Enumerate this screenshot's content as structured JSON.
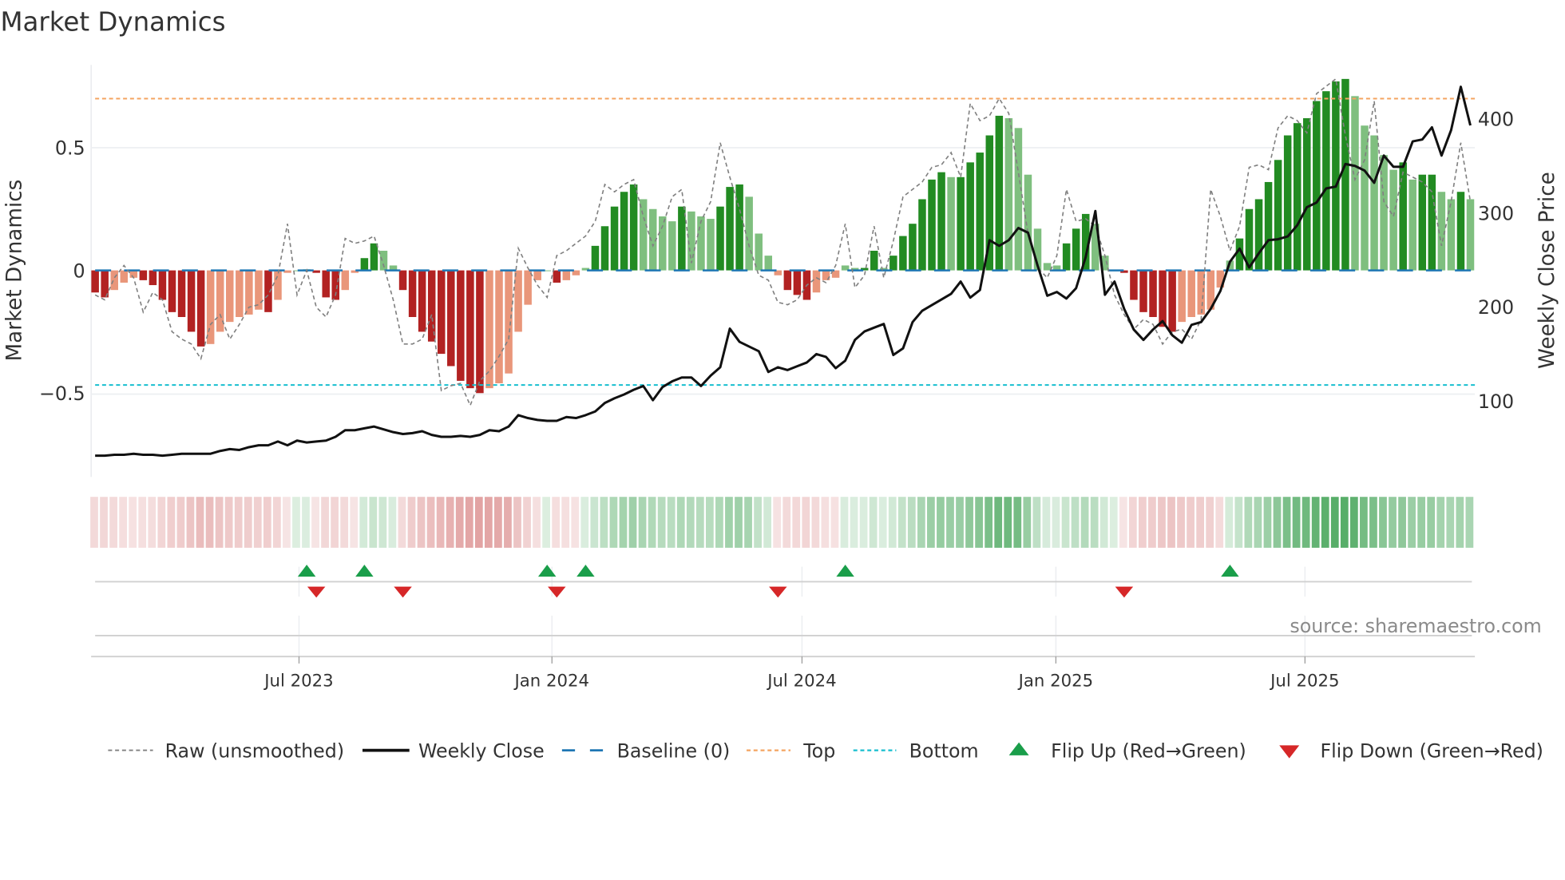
{
  "title": "Market Dynamics",
  "source": "source: sharemaestro.com",
  "legend": {
    "raw": "Raw (unsmoothed)",
    "close": "Weekly Close",
    "baseline": "Baseline (0)",
    "top": "Top",
    "bottom": "Bottom",
    "flip_up": "Flip Up (Red→Green)",
    "flip_down": "Flip Down (Green→Red)"
  },
  "colors": {
    "neg_strong": "#b22222",
    "neg_weak": "#e9967a",
    "pos_strong": "#228b22",
    "pos_weak": "#7fbf7f",
    "raw": "#808080",
    "close": "#111111",
    "baseline": "#1f77b4",
    "top": "#f4a460",
    "bottom": "#17becf",
    "flip_up": "#1a9e4a",
    "flip_down": "#d62728"
  },
  "chart_data": {
    "type": "bar",
    "title": "Market Dynamics",
    "ylabel": "Market Dynamics",
    "ylabel_right": "Weekly Close Price",
    "ylim": [
      -0.8,
      0.85
    ],
    "ylim_right": [
      40,
      440
    ],
    "yticks": [
      {
        "v": 0.5,
        "label": "0.5"
      },
      {
        "v": 0,
        "label": "0"
      },
      {
        "v": -0.5,
        "label": "−0.5"
      }
    ],
    "yticks_right": [
      {
        "v": 100,
        "label": "100"
      },
      {
        "v": 200,
        "label": "200"
      },
      {
        "v": 300,
        "label": "300"
      },
      {
        "v": 400,
        "label": "400"
      }
    ],
    "xticks": [
      {
        "week": 21.2,
        "label": "Jul 2023"
      },
      {
        "week": 47.5,
        "label": "Jan 2024"
      },
      {
        "week": 73.5,
        "label": "Jul 2024"
      },
      {
        "week": 99.9,
        "label": "Jan 2025"
      },
      {
        "week": 125.8,
        "label": "Jul 2025"
      }
    ],
    "top_level": 0.7,
    "bottom_level": -0.467,
    "baseline": 0,
    "histogram": [
      -0.09,
      -0.11,
      -0.08,
      -0.05,
      -0.03,
      -0.04,
      -0.06,
      -0.12,
      -0.17,
      -0.19,
      -0.25,
      -0.31,
      -0.3,
      -0.25,
      -0.21,
      -0.19,
      -0.18,
      -0.16,
      -0.17,
      -0.12,
      -0.01,
      0.0,
      0.004,
      -0.01,
      -0.11,
      -0.12,
      -0.08,
      -0.01,
      0.05,
      0.11,
      0.08,
      0.02,
      -0.08,
      -0.19,
      -0.25,
      -0.29,
      -0.34,
      -0.39,
      -0.45,
      -0.48,
      -0.5,
      -0.48,
      -0.46,
      -0.42,
      -0.25,
      -0.14,
      -0.04,
      0.0,
      -0.05,
      -0.04,
      -0.02,
      0.01,
      0.1,
      0.18,
      0.26,
      0.32,
      0.35,
      0.29,
      0.25,
      0.22,
      0.2,
      0.26,
      0.24,
      0.22,
      0.21,
      0.26,
      0.34,
      0.35,
      0.3,
      0.15,
      0.06,
      -0.02,
      -0.08,
      -0.1,
      -0.12,
      -0.09,
      -0.04,
      -0.03,
      0.02,
      0.01,
      0.01,
      0.08,
      0.01,
      0.06,
      0.14,
      0.19,
      0.29,
      0.37,
      0.4,
      0.38,
      0.38,
      0.44,
      0.48,
      0.55,
      0.63,
      0.62,
      0.58,
      0.39,
      0.17,
      0.03,
      0.02,
      0.11,
      0.17,
      0.23,
      0.19,
      0.06,
      0.0,
      -0.01,
      -0.12,
      -0.17,
      -0.19,
      -0.23,
      -0.25,
      -0.21,
      -0.19,
      -0.18,
      -0.16,
      -0.07,
      0.04,
      0.13,
      0.25,
      0.29,
      0.36,
      0.45,
      0.55,
      0.6,
      0.62,
      0.69,
      0.73,
      0.77,
      0.78,
      0.71,
      0.59,
      0.55,
      0.47,
      0.41,
      0.44,
      0.37,
      0.39,
      0.39,
      0.32,
      0.29,
      0.32,
      0.29
    ],
    "raw": [
      -0.1,
      -0.12,
      -0.03,
      0.02,
      -0.03,
      -0.17,
      -0.09,
      -0.12,
      -0.25,
      -0.28,
      -0.3,
      -0.36,
      -0.22,
      -0.18,
      -0.28,
      -0.22,
      -0.15,
      -0.14,
      -0.1,
      -0.02,
      0.19,
      -0.1,
      0.0,
      -0.15,
      -0.19,
      -0.1,
      0.13,
      0.11,
      0.12,
      0.14,
      0.02,
      -0.12,
      -0.3,
      -0.3,
      -0.28,
      -0.18,
      -0.49,
      -0.47,
      -0.46,
      -0.55,
      -0.45,
      -0.41,
      -0.35,
      -0.28,
      0.09,
      0.01,
      -0.06,
      -0.11,
      0.06,
      0.08,
      0.11,
      0.14,
      0.2,
      0.35,
      0.32,
      0.35,
      0.37,
      0.22,
      0.1,
      0.18,
      0.3,
      0.33,
      0.03,
      0.2,
      0.28,
      0.52,
      0.38,
      0.25,
      0.1,
      -0.02,
      -0.04,
      -0.13,
      -0.14,
      -0.12,
      -0.06,
      -0.03,
      -0.05,
      0.02,
      0.19,
      -0.07,
      -0.02,
      0.18,
      -0.03,
      0.12,
      0.3,
      0.33,
      0.36,
      0.42,
      0.43,
      0.48,
      0.38,
      0.68,
      0.61,
      0.63,
      0.7,
      0.64,
      0.4,
      0.15,
      0.01,
      -0.03,
      0.06,
      0.33,
      0.2,
      0.21,
      0.18,
      0.06,
      -0.1,
      -0.18,
      -0.24,
      -0.2,
      -0.22,
      -0.3,
      -0.25,
      -0.24,
      -0.28,
      -0.2,
      0.33,
      0.22,
      0.08,
      0.18,
      0.42,
      0.43,
      0.41,
      0.58,
      0.63,
      0.61,
      0.56,
      0.72,
      0.75,
      0.78,
      0.55,
      0.37,
      0.45,
      0.69,
      0.28,
      0.22,
      0.4,
      0.38,
      0.36,
      0.32,
      0.1,
      0.28,
      0.52,
      0.28
    ],
    "close": [
      42,
      42,
      43,
      43,
      44,
      43,
      43,
      42,
      43,
      44,
      44,
      44,
      44,
      47,
      49,
      48,
      51,
      53,
      53,
      57,
      53,
      58,
      56,
      57,
      58,
      62,
      69,
      69,
      71,
      73,
      70,
      67,
      65,
      66,
      68,
      64,
      62,
      62,
      63,
      62,
      64,
      69,
      68,
      73,
      85,
      82,
      80,
      79,
      79,
      83,
      82,
      85,
      89,
      98,
      103,
      107,
      112,
      116,
      101,
      115,
      121,
      125,
      125,
      116,
      127,
      136,
      177,
      163,
      158,
      153,
      131,
      136,
      133,
      137,
      141,
      150,
      147,
      135,
      143,
      165,
      174,
      178,
      182,
      149,
      156,
      184,
      196,
      202,
      208,
      214,
      227,
      210,
      218,
      271,
      265,
      271,
      284,
      279,
      244,
      212,
      216,
      209,
      220,
      253,
      302,
      213,
      227,
      198,
      176,
      165,
      176,
      185,
      170,
      162,
      181,
      184,
      198,
      217,
      248,
      262,
      242,
      257,
      271,
      272,
      275,
      287,
      306,
      311,
      326,
      328,
      352,
      350,
      345,
      332,
      361,
      349,
      349,
      376,
      378,
      391,
      361,
      388,
      434,
      393
    ],
    "flip_up_weeks": [
      22,
      28,
      47,
      51,
      78,
      118
    ],
    "flip_down_weeks": [
      23,
      32,
      48,
      71,
      107
    ]
  }
}
